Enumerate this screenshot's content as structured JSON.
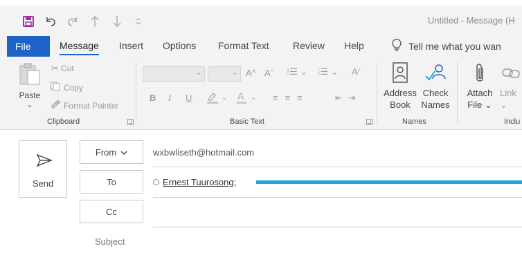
{
  "window": {
    "title": "Untitled  -  Message (H"
  },
  "quick_access": {
    "save_icon": "save-icon",
    "undo_icon": "undo-icon",
    "redo_icon": "redo-icon",
    "up_icon": "arrow-up-icon",
    "down_icon": "arrow-down-icon",
    "customize_icon": "customize-icon"
  },
  "menu": {
    "file": "File",
    "tabs": [
      "Message",
      "Insert",
      "Options",
      "Format Text",
      "Review",
      "Help"
    ],
    "active_tab": "Message",
    "tell_me": "Tell me what you wan"
  },
  "ribbon": {
    "clipboard": {
      "label": "Clipboard",
      "paste": "Paste",
      "cut": "Cut",
      "copy": "Copy",
      "format_painter": "Format Painter"
    },
    "basic_text": {
      "label": "Basic Text",
      "bold": "B",
      "italic": "I",
      "underline": "U",
      "grow_font": "A^",
      "shrink_font": "Aˇ"
    },
    "names": {
      "label": "Names",
      "address_book_l1": "Address",
      "address_book_l2": "Book",
      "check_names_l1": "Check",
      "check_names_l2": "Names"
    },
    "include": {
      "label": "Inclu",
      "attach_l1": "Attach",
      "attach_l2": "File ⌄",
      "link": "Link"
    }
  },
  "compose": {
    "send": "Send",
    "from_label": "From",
    "from_value": "wxbwliseth@hotmail.com",
    "to_label": "To",
    "to_recipient": "Ernest Tuurosong;",
    "cc_label": "Cc",
    "subject_label": "Subject"
  },
  "colors": {
    "accent": "#1e64c8",
    "save": "#a02fa8",
    "progress": "#1fa3d8"
  }
}
